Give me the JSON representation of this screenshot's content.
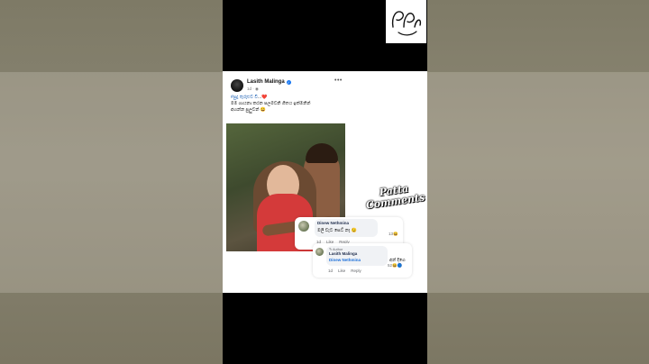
{
  "post": {
    "author": "Lasith Malinga",
    "meta": "1d · ◉",
    "more": "•••",
    "caption_tag": "#පුදු තුරුළුව වී",
    "caption_tag_suffix": "...❤️",
    "caption_line2": "මම ගායනා කරන පලමවනි ගීතය ඉක්මනින්",
    "caption_line3": "අහන්න පුලුවන් 😀"
  },
  "comments": [
    {
      "name": "Dinew Nethmina",
      "text": "මලි වැට සෙට් නෑ 😉",
      "time": "1d",
      "like": "Like",
      "reply": "Reply",
      "count": "13😆"
    },
    {
      "author_badge": "✎ Author",
      "name": "Lasith Malinga",
      "mention": "Dinew Nethmina",
      "text": "අන් දිගෙ",
      "time": "1d",
      "like": "Like",
      "reply": "Reply",
      "count": "52😆🔵"
    }
  ],
  "sticker": {
    "line1": "Patta",
    "line2": "Comments"
  },
  "colors": {
    "verified": "#1877f2",
    "mention": "#1c6fd9",
    "hashtag": "#1a5fb4"
  },
  "icons": [
    "verified-badge-icon",
    "more-options-icon",
    "globe-icon",
    "logo-icon"
  ]
}
